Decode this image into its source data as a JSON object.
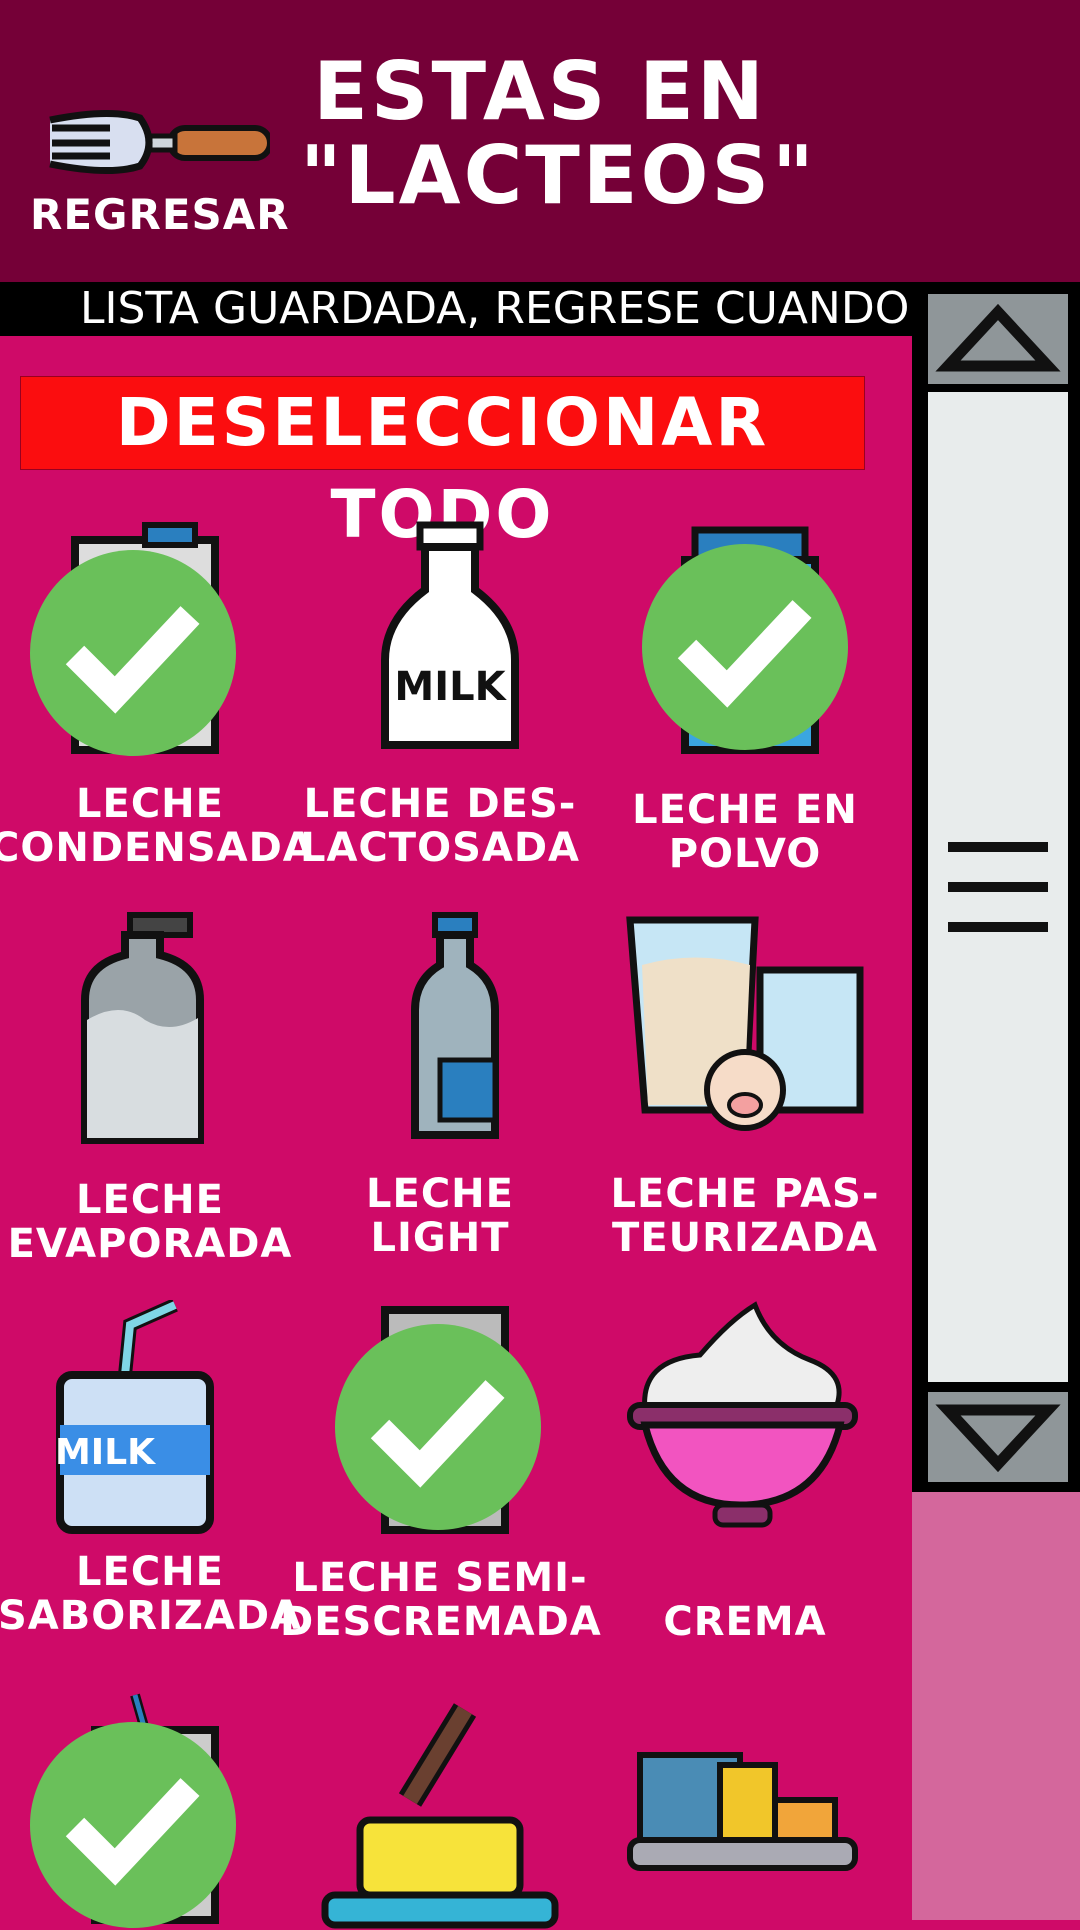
{
  "header": {
    "back_label": "REGRESAR",
    "title_line1": "ESTAS EN",
    "title_line2": "\"LACTEOS\""
  },
  "ticker": {
    "text": "LISTA GUARDADA, REGRESE CUANDO I"
  },
  "deselect_label": "DESELECCIONAR TODO",
  "colors": {
    "header": "#750037",
    "background": "#cf0a68",
    "check": "#6ac05a",
    "deselect": "#fb0d0f"
  },
  "items": [
    {
      "label1": "LECHE",
      "label2": "CONDENSADA",
      "icon": "milk-carton-icon",
      "selected": true
    },
    {
      "label1": "LECHE DES-",
      "label2": "LACTOSADA",
      "icon": "milk-bottle-icon",
      "selected": false
    },
    {
      "label1": "LECHE EN",
      "label2": "POLVO",
      "icon": "powdered-milk-icon",
      "selected": true
    },
    {
      "label1": "LECHE",
      "label2": "EVAPORADA",
      "icon": "evaporated-milk-icon",
      "selected": false
    },
    {
      "label1": "LECHE",
      "label2": "LIGHT",
      "icon": "light-milk-bottle-icon",
      "selected": false
    },
    {
      "label1": "LECHE PAS-",
      "label2": "TEURIZADA",
      "icon": "pasteurized-milk-icon",
      "selected": false
    },
    {
      "label1": "LECHE",
      "label2": "SABORIZADA",
      "icon": "flavored-milk-box-icon",
      "selected": false
    },
    {
      "label1": "LECHE SEMI-",
      "label2": "DESCREMADA",
      "icon": "semi-skimmed-milk-icon",
      "selected": true
    },
    {
      "label1": "",
      "label2": "CREMA",
      "icon": "cream-bowl-icon",
      "selected": false
    },
    {
      "label1": "",
      "label2": "",
      "icon": "drink-icon",
      "selected": true
    },
    {
      "label1": "",
      "label2": "",
      "icon": "butter-icon",
      "selected": false
    },
    {
      "label1": "",
      "label2": "",
      "icon": "cheese-icon",
      "selected": false
    }
  ]
}
